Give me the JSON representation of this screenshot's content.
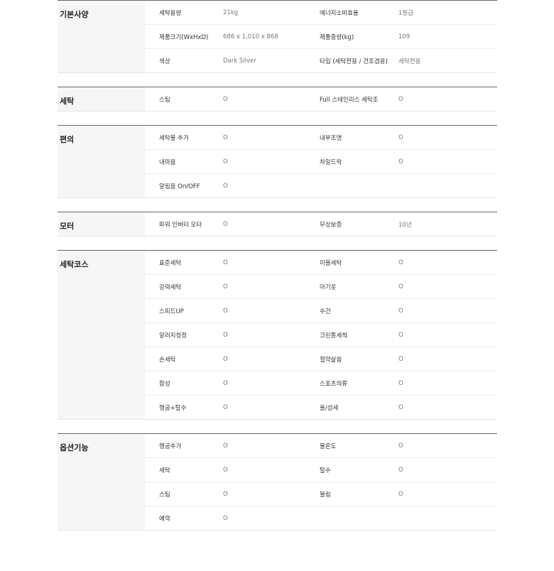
{
  "sections": [
    {
      "title": "기본사양",
      "rows": [
        {
          "l1": "세탁용량",
          "v1": "21kg",
          "l2": "에너지소비효율",
          "v2": "1등급"
        },
        {
          "l1": "제품크기(WxHxD)",
          "v1": "686 x 1,010 x 868",
          "l2": "제품중량(kg)",
          "v2": "109"
        },
        {
          "l1": "색상",
          "v1": "Dark Silver",
          "l2": "타입 (세탁전용 / 건조겸용)",
          "v2": "세탁전용"
        }
      ]
    },
    {
      "title": "세탁",
      "rows": [
        {
          "l1": "스팀",
          "v1": "O",
          "l2": "Full 스테인리스 세탁조",
          "v2": "O"
        }
      ]
    },
    {
      "title": "편의",
      "rows": [
        {
          "l1": "세탁물 추가",
          "v1": "O",
          "l2": "내부조명",
          "v2": "O"
        },
        {
          "l1": "내마음",
          "v1": "O",
          "l2": "차일드락",
          "v2": "O"
        },
        {
          "l1": "알림음 On/OFF",
          "v1": "O",
          "l2": "",
          "v2": ""
        }
      ]
    },
    {
      "title": "모터",
      "rows": [
        {
          "l1": "파워 인버터 모터",
          "v1": "O",
          "l2": "무상보증",
          "v2": "10년"
        }
      ]
    },
    {
      "title": "세탁코스",
      "rows": [
        {
          "l1": "표준세탁",
          "v1": "O",
          "l2": "이불세탁",
          "v2": "O"
        },
        {
          "l1": "강력세탁",
          "v1": "O",
          "l2": "아기옷",
          "v2": "O"
        },
        {
          "l1": "스피드UP",
          "v1": "O",
          "l2": "수건",
          "v2": "O"
        },
        {
          "l1": "알러지청정",
          "v1": "O",
          "l2": "크린통세척",
          "v2": "O"
        },
        {
          "l1": "손세탁",
          "v1": "O",
          "l2": "절약삶음",
          "v2": "O"
        },
        {
          "l1": "합성",
          "v1": "O",
          "l2": "스포츠의류",
          "v2": "O"
        },
        {
          "l1": "헹굼+탈수",
          "v1": "O",
          "l2": "울/섬세",
          "v2": "O"
        }
      ]
    },
    {
      "title": "옵션기능",
      "rows": [
        {
          "l1": "헹굼추가",
          "v1": "O",
          "l2": "물온도",
          "v2": "O"
        },
        {
          "l1": "세탁",
          "v1": "O",
          "l2": "탈수",
          "v2": "O"
        },
        {
          "l1": "스팀",
          "v1": "O",
          "l2": "불림",
          "v2": "O"
        },
        {
          "l1": "예약",
          "v1": "O",
          "l2": "",
          "v2": ""
        }
      ]
    }
  ]
}
